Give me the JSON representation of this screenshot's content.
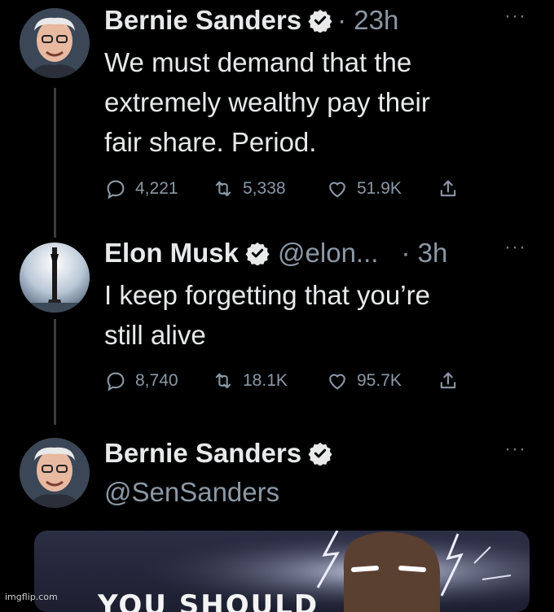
{
  "tweets": [
    {
      "name": "Bernie Sanders",
      "meta": "· 23h",
      "more": "···",
      "text_lines": [
        "We must demand that the",
        "extremely wealthy pay their",
        "fair share. Period."
      ],
      "stats": {
        "replies": "4,221",
        "retweets": "5,338",
        "likes": "51.9K"
      }
    },
    {
      "name": "Elon Musk",
      "handle_inline": "@elon...",
      "meta": "· 3h",
      "more": "···",
      "text_lines": [
        "I keep forgetting that you’re",
        "still alive"
      ],
      "stats": {
        "replies": "8,740",
        "retweets": "18.1K",
        "likes": "95.7K"
      }
    },
    {
      "name": "Bernie Sanders",
      "handle": "@SenSanders",
      "more": "···"
    }
  ],
  "media": {
    "caption": "YOU SHOULD"
  },
  "watermark": "imgflip.com",
  "colors": {
    "background": "#000000",
    "text": "#e7e9ea",
    "muted": "#8b98a5",
    "verified": "#e7e9ea"
  }
}
